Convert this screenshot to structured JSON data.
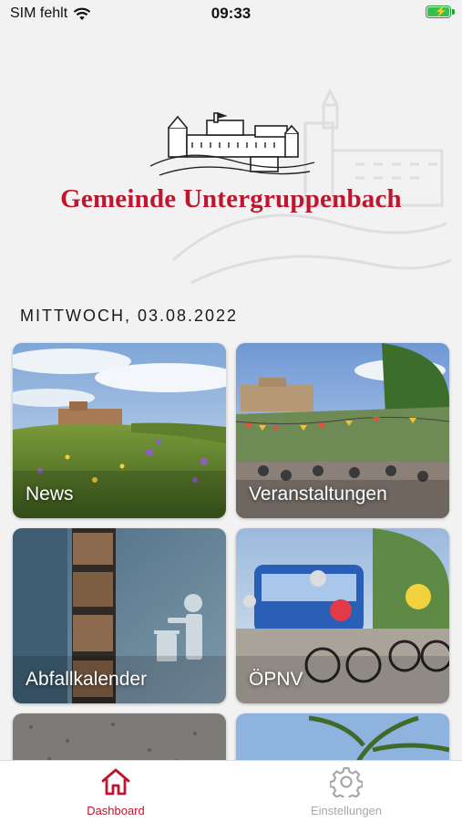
{
  "status_bar": {
    "carrier": "SIM fehlt",
    "time": "09:33"
  },
  "header": {
    "brand": "Gemeinde Untergruppenbach"
  },
  "date": "MITTWOCH, 03.08.2022",
  "tiles": [
    {
      "label": "News"
    },
    {
      "label": "Veranstaltungen"
    },
    {
      "label": "Abfallkalender"
    },
    {
      "label": "ÖPNV"
    }
  ],
  "tabbar": {
    "items": [
      {
        "label": "Dashboard",
        "icon": "home-icon",
        "active": true
      },
      {
        "label": "Einstellungen",
        "icon": "gear-icon",
        "active": false
      }
    ]
  },
  "colors": {
    "brand": "#c0152f",
    "inactive": "#a8a8a8",
    "background": "#f2f2f2"
  }
}
